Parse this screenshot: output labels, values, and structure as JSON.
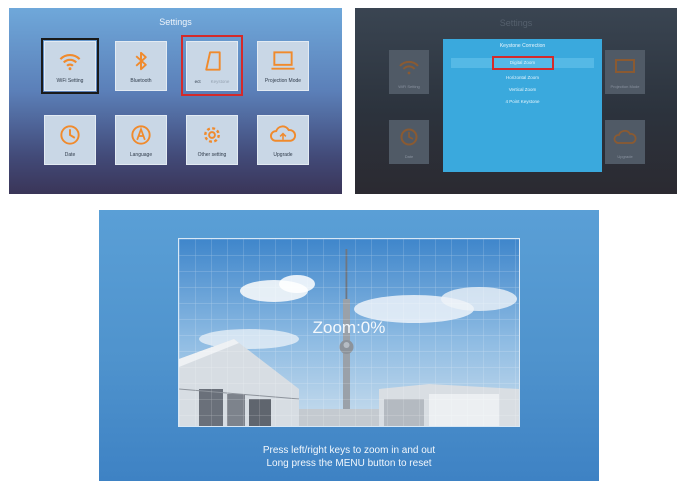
{
  "settings_panel": {
    "title": "Settings",
    "tiles": [
      {
        "label": "WiFi Setting",
        "icon": "wifi-icon"
      },
      {
        "label": "Bluetooth",
        "icon": "bluetooth-icon"
      },
      {
        "label": "Keystone",
        "icon": "keystone-icon"
      },
      {
        "label": "Projection Mode",
        "icon": "projection-mode-icon"
      },
      {
        "label": "Date",
        "icon": "clock-icon"
      },
      {
        "label": "Language",
        "icon": "language-icon"
      },
      {
        "label": "Other setting",
        "icon": "gear-icon"
      },
      {
        "label": "Upgrade",
        "icon": "cloud-upgrade-icon"
      }
    ],
    "keystone_label_suffix": "ect",
    "selected_tile": "WiFi Setting",
    "highlighted_tile": "Keystone",
    "accent_color": "#f08a2c",
    "highlight_color": "#d42a2a"
  },
  "keystone_dialog_panel": {
    "background_title": "Settings",
    "background_tiles": [
      {
        "label": "WiFi Setting",
        "icon": "wifi-icon"
      },
      {
        "label": "Projection Mode",
        "icon": "projection-mode-icon"
      },
      {
        "label": "Date",
        "icon": "clock-icon"
      },
      {
        "label": "Upgrade",
        "icon": "cloud-upgrade-icon"
      }
    ],
    "dialog_title": "Keystone Correction",
    "options": [
      "Digital Zoom",
      "Horizontal Zoom",
      "Vertical Zoom",
      "4 Point Keystone"
    ],
    "active_option": "Digital Zoom",
    "dialog_color": "#3aa9dd"
  },
  "zoom_panel": {
    "zoom_label": "Zoom:0%",
    "hint_line_1": "Press left/right keys to zoom in and out",
    "hint_line_2": "Long press the MENU button to reset"
  }
}
